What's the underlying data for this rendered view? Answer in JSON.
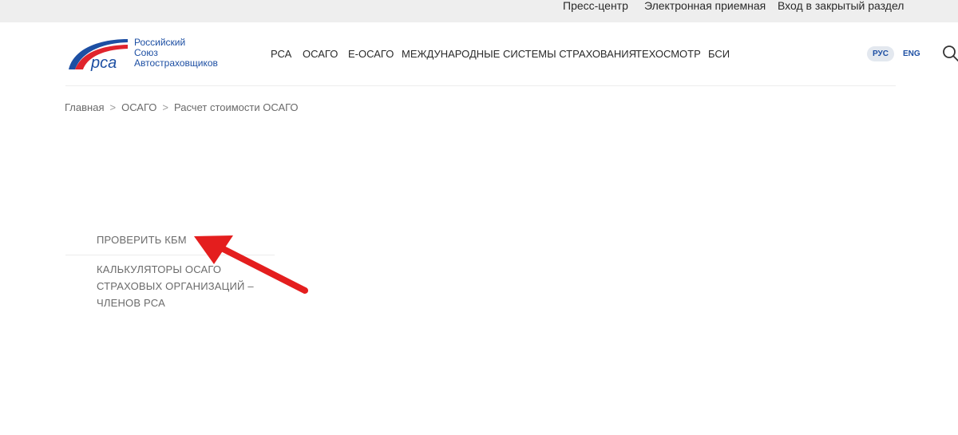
{
  "topbar": {
    "links": [
      "Пресс-центр",
      "Электронная приемная",
      "Вход в закрытый раздел"
    ]
  },
  "logo": {
    "mark": "рса",
    "lines": [
      "Российский",
      "Союз",
      "Автостраховщиков"
    ],
    "colors": {
      "blue": "#1d4fa3",
      "red": "#e0242d"
    }
  },
  "nav": {
    "items": [
      "РСА",
      "ОСАГО",
      "Е-ОСАГО",
      "МЕЖДУНАРОДНЫЕ СИСТЕМЫ СТРАХОВАНИЯ",
      "ТЕХОСМОТР",
      "БСИ"
    ]
  },
  "lang": {
    "active": "РУС",
    "other": "ENG"
  },
  "icons": {
    "search": "search-icon"
  },
  "breadcrumb": {
    "items": [
      "Главная",
      "ОСАГО",
      "Расчет стоимости ОСАГО"
    ],
    "separator": ">"
  },
  "side_menu": {
    "items": [
      "ПРОВЕРИТЬ КБМ",
      [
        "КАЛЬКУЛЯТОРЫ ОСАГО",
        "СТРАХОВЫХ ОРГАНИЗАЦИЙ –",
        "ЧЛЕНОВ РСА"
      ]
    ]
  },
  "annotation": {
    "arrow_color": "#e41e1e"
  }
}
